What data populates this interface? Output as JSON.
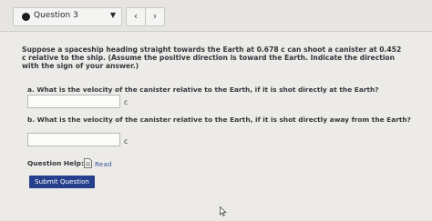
{
  "header": {
    "question_label": "Question 3",
    "prev_icon": "chevron-left-icon",
    "next_icon": "chevron-right-icon"
  },
  "question": {
    "text": "Suppose a spaceship heading straight towards the Earth at 0.678 c can shoot a canister at 0.452 c relative to the ship. (Assume the positive direction is toward the Earth. Indicate the direction with the sign of your answer.)"
  },
  "parts": [
    {
      "prompt": "a. What is the velocity of the canister relative to the Earth, if it is shot directly at the Earth?",
      "value": "",
      "unit": "c"
    },
    {
      "prompt": "b. What is the velocity of the canister relative to the Earth, if it is shot directly away from the Earth?",
      "value": "",
      "unit": "c"
    }
  ],
  "help": {
    "label": "Question Help:",
    "read_label": "Read"
  },
  "submit_label": "Submit Question"
}
